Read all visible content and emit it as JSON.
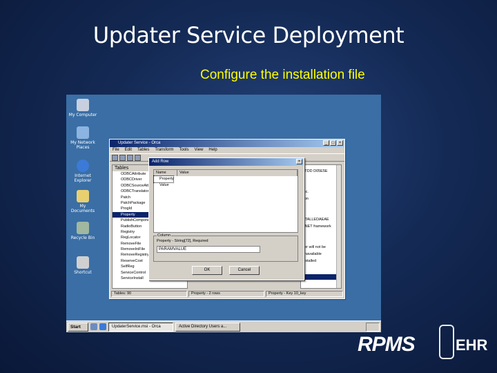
{
  "slide": {
    "title": "Updater Service Deployment",
    "subtitle": "Configure the installation file"
  },
  "desktop_icons": [
    {
      "label": "My Computer",
      "icon": "computer-icon",
      "color": "#c8d0e0"
    },
    {
      "label": "My Network Places",
      "icon": "network-icon",
      "color": "#8cb4e0"
    },
    {
      "label": "Internet Explorer",
      "icon": "ie-icon",
      "color": "#3c7ad8"
    },
    {
      "label": "My Documents",
      "icon": "folder-icon",
      "color": "#e8d070"
    },
    {
      "label": "Recycle Bin",
      "icon": "recycle-bin-icon",
      "color": "#a0b8a0"
    },
    {
      "label": "Shortcut",
      "icon": "shortcut-icon",
      "color": "#d0d0d0"
    }
  ],
  "main_window": {
    "title": "Updater Service - Orca",
    "menu": [
      "File",
      "Edit",
      "Tables",
      "Transform",
      "Tools",
      "View",
      "Help"
    ],
    "tables_header": "Tables",
    "tables": [
      "ODBCAttribute",
      "ODBCDriver",
      "ODBCSourceAttr",
      "ODBCTranslator",
      "Patch",
      "PatchPackage",
      "ProgId",
      "Property",
      "PublishComponent",
      "RadioButton",
      "Registry",
      "RegLocator",
      "RemoveFile",
      "RemoveIniFile",
      "RemoveRegistry",
      "ReserveCost",
      "SelfReg",
      "ServiceControl",
      "ServiceInstall"
    ],
    "selected_table": "Property",
    "right_pane_items": [
      "ATDD D05E5E",
      "Inc.",
      "tion",
      "STALLEDAEAE",
      "ANET framework",
      "ber will not be",
      "unavailable",
      "installed"
    ],
    "status": [
      "Tables: 90",
      "Property - 2 rows",
      "Property - Key 10_key"
    ]
  },
  "dialog": {
    "title": "Add Row",
    "col_name": "Name",
    "col_value": "Value",
    "rows": [
      "Property",
      "Value"
    ],
    "group_label": "Column",
    "prop_label": "Property - String[72], Required",
    "input_value": "PARAMVALUE",
    "ok_label": "OK",
    "cancel_label": "Cancel"
  },
  "taskbar": {
    "start_label": "Start",
    "tasks": [
      "UpdaterService.msi - Orca",
      "Active Directory Users a..."
    ]
  },
  "logo": {
    "brand": "RPMS",
    "suffix": "EHR"
  }
}
